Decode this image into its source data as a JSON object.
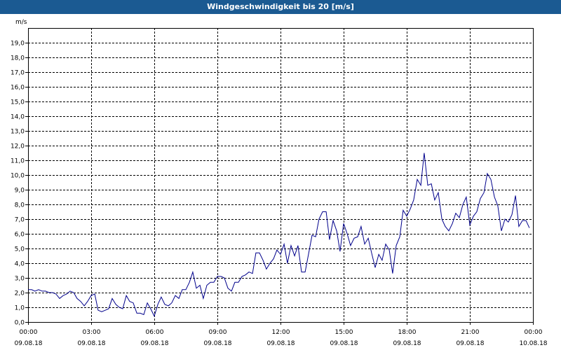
{
  "window": {
    "title": "Windgeschwindigkeit bis 20 [m/s]"
  },
  "chart_data": {
    "type": "line",
    "title": "Windgeschwindigkeit bis 20 [m/s]",
    "ylabel": "m/s",
    "xlabel": "",
    "ylim": [
      0,
      20
    ],
    "y_ticks": [
      "0,0",
      "1,0",
      "2,0",
      "3,0",
      "4,0",
      "5,0",
      "6,0",
      "7,0",
      "8,0",
      "9,0",
      "10,0",
      "11,0",
      "12,0",
      "13,0",
      "14,0",
      "15,0",
      "16,0",
      "17,0",
      "18,0",
      "19,0"
    ],
    "x_unit": "hours since 09.08.18 00:00",
    "xlim": [
      0,
      24
    ],
    "x_ticks": [
      {
        "time": "00:00",
        "date": "09.08.18"
      },
      {
        "time": "03:00",
        "date": "09.08.18"
      },
      {
        "time": "06:00",
        "date": "09.08.18"
      },
      {
        "time": "09:00",
        "date": "09.08.18"
      },
      {
        "time": "12:00",
        "date": "09.08.18"
      },
      {
        "time": "15:00",
        "date": "09.08.18"
      },
      {
        "time": "18:00",
        "date": "09.08.18"
      },
      {
        "time": "21:00",
        "date": "09.08.18"
      },
      {
        "time": "00:00",
        "date": "10.08.18"
      }
    ],
    "grid": true,
    "line_color": "#00008b",
    "series": [
      {
        "name": "",
        "points": [
          [
            0.0,
            2.2
          ],
          [
            0.17,
            2.2
          ],
          [
            0.33,
            2.1
          ],
          [
            0.5,
            2.2
          ],
          [
            0.67,
            2.1
          ],
          [
            0.83,
            2.1
          ],
          [
            1.0,
            2.0
          ],
          [
            1.17,
            2.0
          ],
          [
            1.33,
            1.9
          ],
          [
            1.5,
            1.6
          ],
          [
            1.67,
            1.8
          ],
          [
            1.83,
            1.9
          ],
          [
            2.0,
            2.1
          ],
          [
            2.17,
            2.0
          ],
          [
            2.33,
            1.6
          ],
          [
            2.5,
            1.4
          ],
          [
            2.67,
            1.1
          ],
          [
            2.83,
            1.4
          ],
          [
            3.0,
            1.8
          ],
          [
            3.17,
            1.9
          ],
          [
            3.33,
            0.8
          ],
          [
            3.5,
            0.7
          ],
          [
            3.67,
            0.8
          ],
          [
            3.83,
            0.9
          ],
          [
            4.0,
            1.6
          ],
          [
            4.17,
            1.2
          ],
          [
            4.33,
            1.0
          ],
          [
            4.5,
            0.9
          ],
          [
            4.67,
            1.8
          ],
          [
            4.83,
            1.4
          ],
          [
            5.0,
            1.3
          ],
          [
            5.17,
            0.6
          ],
          [
            5.33,
            0.6
          ],
          [
            5.5,
            0.5
          ],
          [
            5.67,
            1.3
          ],
          [
            5.83,
            0.9
          ],
          [
            6.0,
            0.4
          ],
          [
            6.17,
            1.2
          ],
          [
            6.33,
            1.7
          ],
          [
            6.5,
            1.2
          ],
          [
            6.67,
            1.1
          ],
          [
            6.83,
            1.3
          ],
          [
            7.0,
            1.8
          ],
          [
            7.17,
            1.6
          ],
          [
            7.33,
            2.2
          ],
          [
            7.5,
            2.2
          ],
          [
            7.67,
            2.7
          ],
          [
            7.83,
            3.4
          ],
          [
            8.0,
            2.3
          ],
          [
            8.17,
            2.5
          ],
          [
            8.33,
            1.6
          ],
          [
            8.5,
            2.5
          ],
          [
            8.67,
            2.7
          ],
          [
            8.83,
            2.7
          ],
          [
            9.0,
            3.1
          ],
          [
            9.17,
            3.1
          ],
          [
            9.33,
            3.0
          ],
          [
            9.5,
            2.3
          ],
          [
            9.67,
            2.1
          ],
          [
            9.83,
            2.7
          ],
          [
            10.0,
            2.7
          ],
          [
            10.17,
            3.1
          ],
          [
            10.33,
            3.2
          ],
          [
            10.5,
            3.4
          ],
          [
            10.67,
            3.3
          ],
          [
            10.83,
            4.7
          ],
          [
            11.0,
            4.7
          ],
          [
            11.17,
            4.2
          ],
          [
            11.33,
            3.6
          ],
          [
            11.5,
            4.0
          ],
          [
            11.67,
            4.3
          ],
          [
            11.83,
            4.9
          ],
          [
            12.0,
            4.6
          ],
          [
            12.17,
            5.3
          ],
          [
            12.33,
            4.0
          ],
          [
            12.5,
            5.2
          ],
          [
            12.67,
            4.5
          ],
          [
            12.83,
            5.2
          ],
          [
            13.0,
            3.4
          ],
          [
            13.17,
            3.4
          ],
          [
            13.33,
            4.6
          ],
          [
            13.5,
            5.9
          ],
          [
            13.67,
            5.8
          ],
          [
            13.83,
            7.0
          ],
          [
            14.0,
            7.5
          ],
          [
            14.17,
            7.5
          ],
          [
            14.33,
            5.6
          ],
          [
            14.5,
            6.9
          ],
          [
            14.67,
            6.2
          ],
          [
            14.83,
            4.8
          ],
          [
            15.0,
            6.7
          ],
          [
            15.17,
            6.0
          ],
          [
            15.33,
            5.2
          ],
          [
            15.5,
            5.7
          ],
          [
            15.67,
            5.8
          ],
          [
            15.83,
            6.5
          ],
          [
            16.0,
            5.3
          ],
          [
            16.17,
            5.7
          ],
          [
            16.33,
            4.7
          ],
          [
            16.5,
            3.7
          ],
          [
            16.67,
            4.6
          ],
          [
            16.83,
            4.2
          ],
          [
            17.0,
            5.3
          ],
          [
            17.17,
            4.9
          ],
          [
            17.33,
            3.3
          ],
          [
            17.5,
            5.2
          ],
          [
            17.67,
            5.8
          ],
          [
            17.83,
            7.6
          ],
          [
            18.0,
            7.2
          ],
          [
            18.17,
            7.7
          ],
          [
            18.33,
            8.3
          ],
          [
            18.5,
            9.7
          ],
          [
            18.67,
            9.3
          ],
          [
            18.83,
            11.5
          ],
          [
            19.0,
            9.3
          ],
          [
            19.17,
            9.4
          ],
          [
            19.33,
            8.3
          ],
          [
            19.5,
            8.8
          ],
          [
            19.67,
            7.0
          ],
          [
            19.83,
            6.5
          ],
          [
            20.0,
            6.2
          ],
          [
            20.17,
            6.7
          ],
          [
            20.33,
            7.4
          ],
          [
            20.5,
            7.1
          ],
          [
            20.67,
            8.0
          ],
          [
            20.83,
            8.5
          ],
          [
            21.0,
            6.6
          ],
          [
            21.17,
            7.2
          ],
          [
            21.33,
            7.5
          ],
          [
            21.5,
            8.4
          ],
          [
            21.67,
            8.8
          ],
          [
            21.83,
            10.1
          ],
          [
            22.0,
            9.7
          ],
          [
            22.17,
            8.5
          ],
          [
            22.33,
            7.9
          ],
          [
            22.5,
            6.2
          ],
          [
            22.67,
            7.0
          ],
          [
            22.83,
            6.8
          ],
          [
            23.0,
            7.3
          ],
          [
            23.17,
            8.6
          ],
          [
            23.33,
            6.5
          ],
          [
            23.5,
            6.9
          ],
          [
            23.67,
            6.9
          ],
          [
            23.83,
            6.4
          ]
        ]
      }
    ]
  }
}
